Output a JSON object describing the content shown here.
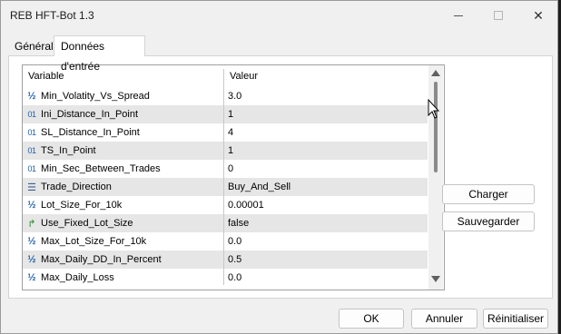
{
  "window": {
    "title": "REB HFT-Bot 1.3"
  },
  "tabs": [
    {
      "label": "Général",
      "active": false
    },
    {
      "label": "Données d'entrée",
      "active": true
    }
  ],
  "grid": {
    "columns": {
      "variable": "Variable",
      "value": "Valeur"
    },
    "rows": [
      {
        "icon": "fraction-icon",
        "name": "Min_Volatity_Vs_Spread",
        "value": "3.0"
      },
      {
        "icon": "integer-icon",
        "name": "Ini_Distance_In_Point",
        "value": "1"
      },
      {
        "icon": "integer-icon",
        "name": "SL_Distance_In_Point",
        "value": "4"
      },
      {
        "icon": "integer-icon",
        "name": "TS_In_Point",
        "value": "1"
      },
      {
        "icon": "integer-icon",
        "name": "Min_Sec_Between_Trades",
        "value": "0"
      },
      {
        "icon": "enum-icon",
        "name": "Trade_Direction",
        "value": "Buy_And_Sell"
      },
      {
        "icon": "fraction-icon",
        "name": "Lot_Size_For_10k",
        "value": "0.00001"
      },
      {
        "icon": "boolean-icon",
        "name": "Use_Fixed_Lot_Size",
        "value": "false"
      },
      {
        "icon": "fraction-icon",
        "name": "Max_Lot_Size_For_10k",
        "value": "0.0"
      },
      {
        "icon": "fraction-icon",
        "name": "Max_Daily_DD_In_Percent",
        "value": "0.5"
      },
      {
        "icon": "fraction-icon",
        "name": "Max_Daily_Loss",
        "value": "0.0"
      }
    ]
  },
  "side_buttons": {
    "load": "Charger",
    "save": "Sauvegarder"
  },
  "footer_buttons": {
    "ok": "OK",
    "cancel": "Annuler",
    "reset": "Réinitialiser"
  },
  "colors": {
    "window_bg": "#f0f0f0",
    "row_alt": "#e6e6e6",
    "icon_blue": "#1f5fa8",
    "icon_green": "#2e8b2e"
  }
}
